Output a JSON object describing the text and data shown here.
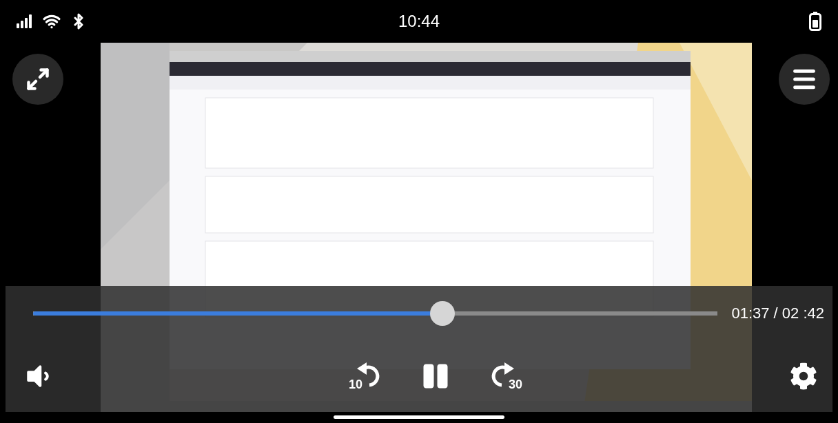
{
  "status_bar": {
    "time": "10:44"
  },
  "player": {
    "progress": {
      "level": 0.598
    },
    "time": "01:37 / 02 :42",
    "rewind_seconds": "10",
    "forward_seconds": "30",
    "playing": true
  }
}
